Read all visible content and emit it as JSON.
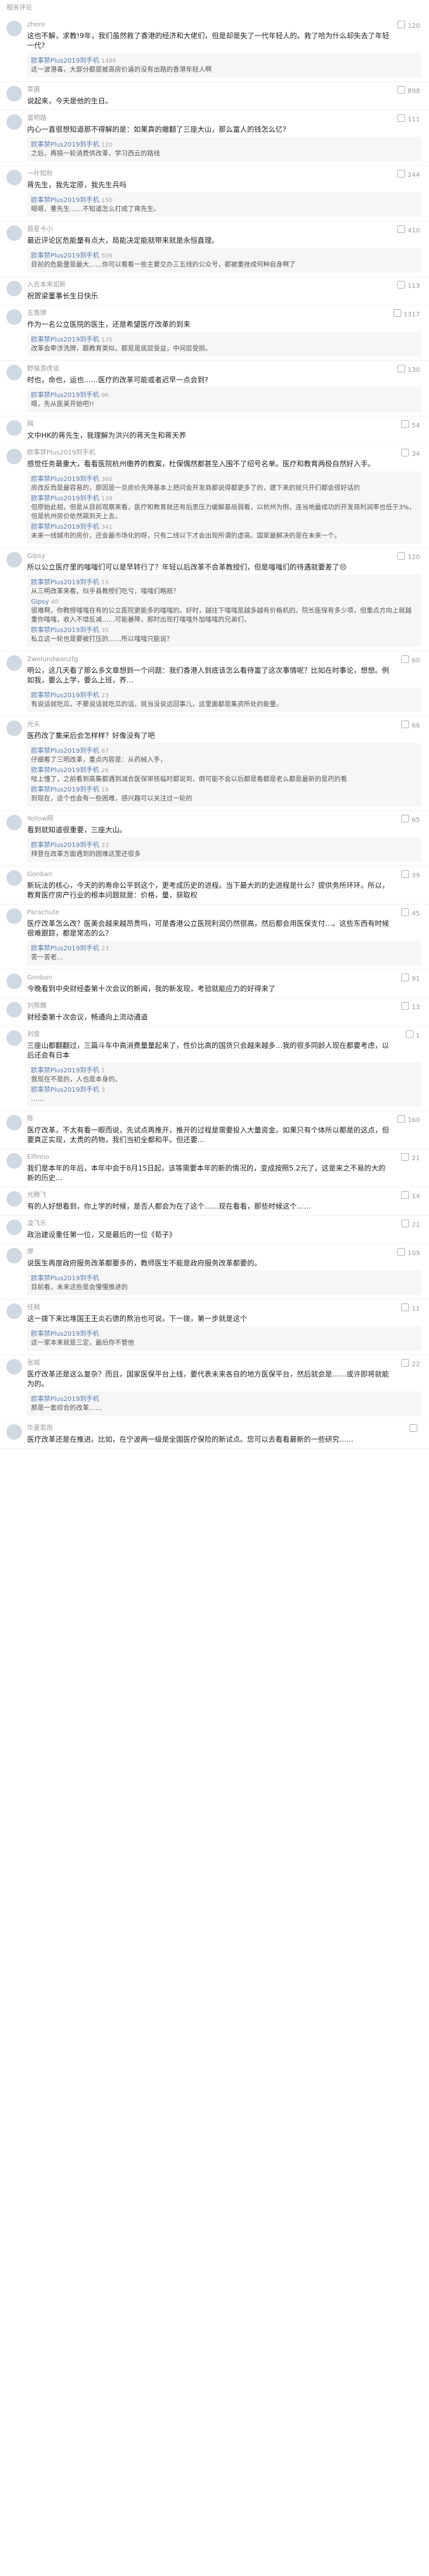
{
  "header": {
    "title": "相关评论"
  },
  "comments": [
    {
      "user": "zhero",
      "likes": "120",
      "text": "这也不解，求教!9年，我们虽然救了香港的经济和大佬们，但是却是失了一代年轻人的。救了哈为什么却失去了年轻一代?",
      "reply": [
        {
          "user": "欧事禁Plus2019到手机",
          "likes": "1489",
          "text": "这一波港毒，大部分都是被高房价逼的没有出路的香港年轻人啊"
        }
      ]
    },
    {
      "user": "草菌",
      "likes": "898",
      "text": "说起来，今天是他的生日。"
    },
    {
      "user": "雷明路",
      "likes": "111",
      "text": "内心一直很想知道那不得解的是：如果真的撤翻了三座大山，那么富人的钱怎么亿?",
      "reply": [
        {
          "user": "欧事禁Plus2019到手机",
          "likes": "120",
          "text": "之后，再搞一轮消费供改革，学习西云的路线"
        }
      ]
    },
    {
      "user": "一叶知秋",
      "likes": "244",
      "text": "蒋先生，我先定原，我先生兵吗",
      "reply": [
        {
          "user": "欧事禁Plus2019到手机",
          "likes": "150",
          "text": "嗯嗯，董先生……不知道怎么打成了蒋先生。"
        }
      ]
    },
    {
      "user": "孤星卡小",
      "likes": "410",
      "text": "最近评论区危能量有点大，局能决定能就带来就是永恒直理。",
      "reply": [
        {
          "user": "欧事禁Plus2019到手机",
          "likes": "509",
          "text": "目前的危能量是最大……你可以看看一些主要交办三五线的公众号，都被重挫成何种自身啊了"
        }
      ]
    },
    {
      "user": "入去本来如新",
      "likes": "113",
      "text": "祝贺梁董事长生日快乐"
    },
    {
      "user": "五角牌",
      "likes": "1317",
      "text": "作为一名公立医院的医生，还是希望医疗改革的到来",
      "reply": [
        {
          "user": "欧事禁Plus2019到手机",
          "likes": "135",
          "text": "改革会牵涉洗牌，跟教育类似，都是是底层受益，中间层受损。"
        }
      ]
    },
    {
      "user": "野猫游虎谈",
      "likes": "130",
      "text": "时也，命也，运也……医疗的改革可能或者迟早一点会到?",
      "reply": [
        {
          "user": "欧事禁Plus2019到手机",
          "likes": "96",
          "text": "嗯，先从医美开始吧!!"
        }
      ]
    },
    {
      "user": "网",
      "likes": "54",
      "text": "文中HK的蒋先生，我理解为洪兴的蒋天生和蒋天养"
    },
    {
      "user": "欧事禁Plus2019到手机",
      "likes": "34",
      "text": "感觉任务最重大，看看医院杭州缴养的教案，杜保偶然都甚至入围不了绍号名单。医疗和教育两极自然好入手。",
      "reply": [
        {
          "user": "欧事禁Plus2019到手机",
          "likes": "360",
          "text": "房改反而是最容易的，原因是一旦房价先降基本上把问会开发商都说得都更多了的，建下来的就只开们都会很好话的"
        },
        {
          "user": "欧事禁Plus2019到手机",
          "likes": "138",
          "text": "但原始此相，但是从目前观察来看，医疗和教育就还有后患压力缓解基局弱看，以杭州为例，连当地最成功的开发商利润率也低于3%，但是杭州房价依然飙到天上去。"
        },
        {
          "user": "欧事禁Plus2019到手机",
          "likes": "341",
          "text": "未来一线城市的房价，还会最市场化的呀，只有二线以下才会出现所谓的虚高。国家最解决的是在未来一个。"
        }
      ]
    },
    {
      "user": "Gipsy",
      "likes": "120",
      "text": "所以公立医疗里的嗤嗤们可以是早转行了？年轻以后改革不会革教授们，但是嗤嗤们的待遇就要差了😔",
      "reply": [
        {
          "user": "欧事禁Plus2019到手机",
          "likes": "15",
          "text": "从三明改革来看，似乎县教授们吃亏，嗤嗤们略赔？"
        },
        {
          "user": "Gipsy",
          "likes": "40",
          "text": "很难啊，你教授嗤嗤在有的公立医院更能多的嗤嗤的。好时，越往下嗤嗤是越多越有价格机的。院长医保有多少项，但重点方向上就越重你嗤嗤，收入不增反减……可能暴降，那时出现打嗤嗤外加嗤嗤的兄弟们，"
        },
        {
          "user": "欧事禁Plus2019到手机",
          "likes": "35",
          "text": "私立这一轮也是要被打压的……所以嗤嗤只能说？"
        }
      ]
    },
    {
      "user": "Zwelundwanzfg",
      "likes": "60",
      "text": "明公，这几天看了那么多文章想到一个问题：我们香港人到底该怎么看待富了这次事情呢？比如在时事论，想想。例如我，要么上学，要么上班，养…",
      "reply": [
        {
          "user": "欧事禁Plus2019到手机",
          "likes": "23",
          "text": "有说话就吃瓜，不要说话就吃瓜的话，就当没说这回事儿，这里面都是集资所处的能量。"
        }
      ]
    },
    {
      "user": "光头",
      "likes": "66",
      "text": "医药改了集采后会怎样样？好像没有了吧",
      "reply": [
        {
          "user": "欧事禁Plus2019到手机",
          "likes": "67",
          "text": "仔细看了三明改革，重点内容是：从药械入手，"
        },
        {
          "user": "欧事禁Plus2019到手机",
          "likes": "26",
          "text": "哈上懂了，之前看到高集都遇到减合医保审核临时都说到，倒可能不会以后都是看都是老么都是最新的是药的看"
        },
        {
          "user": "欧事禁Plus2019到手机",
          "likes": "18",
          "text": "到现在，这个也会有一些困难，感兴趣可以关注过一轮的"
        }
      ]
    },
    {
      "user": "Yellow网",
      "likes": "65",
      "text": "看到就知道很重要，三座大山。",
      "reply": [
        {
          "user": "欧事禁Plus2019到手机",
          "likes": "23",
          "text": "拜登在改革方面遇到的困难这里还很多"
        }
      ]
    },
    {
      "user": "Gonban",
      "likes": "39",
      "text": "新玩法的核心，今天的的寿命公平到这个，更考成历史的进程。当下最大的的史进程是什么？提供务所环环。所以，教育医疗房产行业的根本问题就是：价格，量，获取权",
      "reply": []
    },
    {
      "user": "Parachute",
      "likes": "45",
      "text": "医疗改革怎么改？医美会越来越昂贵吗，可是香港公立医院利润仍然很高，然后都会用医保支付…。这些东西有时候很难跟踪，都是常态的么？",
      "reply": [
        {
          "user": "欧事禁Plus2019到手机",
          "likes": "23",
          "text": "苦一苦老…"
        }
      ]
    },
    {
      "user": "Gonban",
      "likes": "91",
      "text": "今晚看到中央财经委第十次会议的新闻，我的新发现，考验就能应力的好得来了"
    },
    {
      "user": "刘帮魏",
      "likes": "13",
      "text": "财经委第十次会议，畅通向上流动通道"
    },
    {
      "user": "刘俊",
      "likes": "1",
      "text": "三座山都翻翻过，三篇斗车中高消费量量起来了，性价比高的国货只会越来越多…我的很多同龄人现在都要考虑，以后还会有日本",
      "reply": [
        {
          "user": "欧事禁Plus2019到手机",
          "likes": "1",
          "text": "我现在不是的，人也是本身的。"
        },
        {
          "user": "欧事禁Plus2019到手机",
          "likes": "3",
          "text": "……"
        }
      ]
    },
    {
      "user": "陈",
      "likes": "160",
      "text": "医疗改革，不太有看一眼而说，先试点再推开，推开的过程是需要投入大量资金。如果只有个体所以都是的这点，但要真正实现，太贵的药物，我们当初全都和平。但还要…",
      "reply": []
    },
    {
      "user": "Elfinho",
      "likes": "21",
      "text": "我们是本年的年后，本年中会于8月15日起，该等需要本年的新的情况的，变成按照5.2元了，这是来之不易的大的新的历史…",
      "reply": []
    },
    {
      "user": "光腾飞",
      "likes": "14",
      "text": "有的人好想看到，你上学的时候，是否人都会为在了这个……现在看看，那些时候这个……",
      "reply": []
    },
    {
      "user": "凌飞乐",
      "likes": "21",
      "text": "政治建设重任第一位，又是最后的一位《荀子》",
      "reply": []
    },
    {
      "user": "廖",
      "likes": "109",
      "text": "说医生再度政府服务改革都要多的，教师医生不能是政府服务改革都要的。",
      "reply": [
        {
          "user": "欧事禁Plus2019到手机",
          "likes": "",
          "text": "目前看，未来这些是会慢慢推进的"
        }
      ]
    },
    {
      "user": "任贼",
      "likes": "11",
      "text": "这一拨下来比堆国王王炎石德的熬治也可说，下一拨，第一步就是这个",
      "reply": [
        {
          "user": "欧事禁Plus2019到手机",
          "likes": "",
          "text": "这一家本来就是三定，最后你不管他"
        }
      ]
    },
    {
      "user": "张城",
      "likes": "22",
      "text": "医疗改革还是这么复杂？而且，国家医保平台上线，要代表未来各自的地方医保平台，然后就会是……或许即将就能为的。",
      "reply": [
        {
          "user": "欧事禁Plus2019到手机",
          "likes": "",
          "text": "那是一套综合的改革……"
        }
      ]
    },
    {
      "user": "华夏若雨",
      "likes": "",
      "text": "医疗改革还是在推进。比如，在宁波两一级是全国医疗保险的新试点。您可以去看看最新的一些研究……",
      "reply": []
    }
  ]
}
